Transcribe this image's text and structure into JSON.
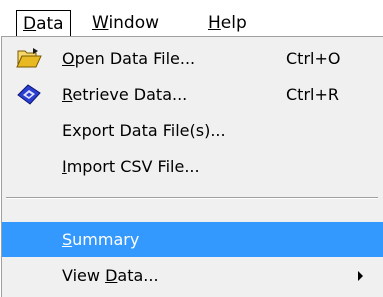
{
  "menubar": {
    "items": [
      {
        "label_pre": "",
        "label_u": "D",
        "label_post": "ata"
      },
      {
        "label_pre": "",
        "label_u": "W",
        "label_post": "indow"
      },
      {
        "label_pre": "",
        "label_u": "H",
        "label_post": "elp"
      }
    ]
  },
  "menu": {
    "items": [
      {
        "icon": "open-folder-icon",
        "label_pre": "",
        "label_u": "O",
        "label_post": "pen Data File...",
        "accel": "Ctrl+O"
      },
      {
        "icon": "retrieve-arrow-icon",
        "label_pre": "",
        "label_u": "R",
        "label_post": "etrieve Data...",
        "accel": "Ctrl+R"
      },
      {
        "label_pre": "Export Data File(s)...",
        "label_u": "",
        "label_post": "",
        "accel": ""
      },
      {
        "label_pre": "",
        "label_u": "I",
        "label_post": "mport CSV File...",
        "accel": ""
      },
      {
        "label_pre": "",
        "label_u": "S",
        "label_post": "ummary",
        "accel": "",
        "highlighted": true
      },
      {
        "label_pre": "View ",
        "label_u": "D",
        "label_post": "ata...",
        "accel": "",
        "submenu": true
      }
    ]
  },
  "colors": {
    "highlight": "#3399ff",
    "menu_bg": "#f0f0f0",
    "folder": "#e8b923",
    "retrieve": "#2a3fd1"
  }
}
